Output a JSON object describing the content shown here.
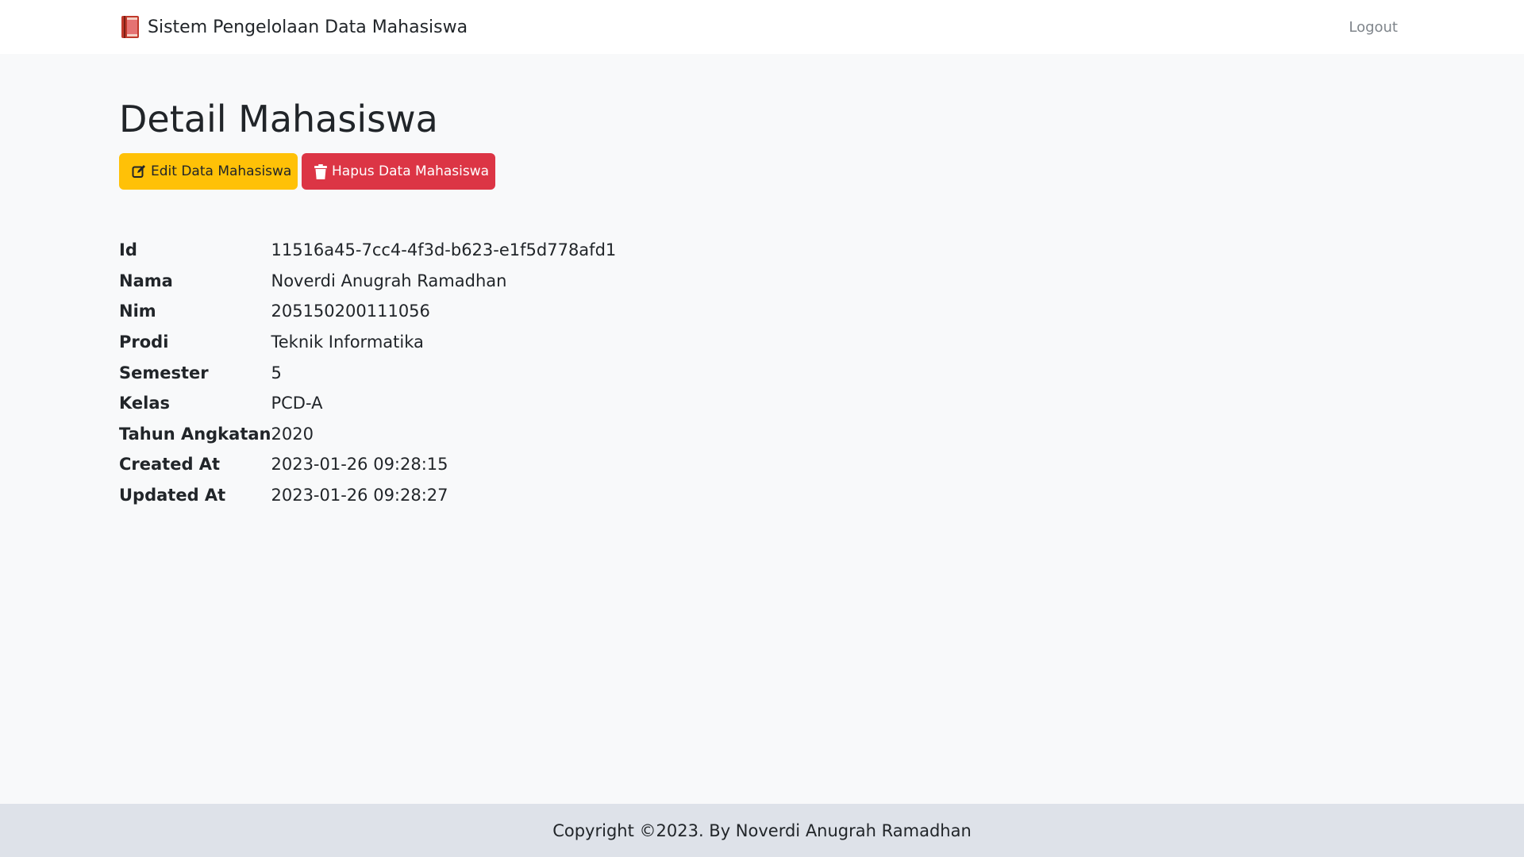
{
  "navbar": {
    "brand_icon": "book-icon",
    "brand_text": "Sistem Pengelolaan Data Mahasiswa",
    "logout_label": "Logout"
  },
  "page": {
    "title": "Detail Mahasiswa"
  },
  "actions": {
    "edit": {
      "icon": "edit-icon",
      "label": "Edit Data Mahasiswa",
      "color": "#ffc107"
    },
    "delete": {
      "icon": "trash-icon",
      "label": "Hapus Data Mahasiswa",
      "color": "#dc3545"
    }
  },
  "details": [
    {
      "label": "Id",
      "value": "11516a45-7cc4-4f3d-b623-e1f5d778afd1"
    },
    {
      "label": "Nama",
      "value": "Noverdi Anugrah Ramadhan"
    },
    {
      "label": "Nim",
      "value": "205150200111056"
    },
    {
      "label": "Prodi",
      "value": "Teknik Informatika"
    },
    {
      "label": "Semester",
      "value": "5"
    },
    {
      "label": "Kelas",
      "value": "PCD-A"
    },
    {
      "label": "Tahun Angkatan",
      "value": "2020"
    },
    {
      "label": "Created At",
      "value": "2023-01-26 09:28:15"
    },
    {
      "label": "Updated At",
      "value": "2023-01-26 09:28:27"
    }
  ],
  "footer": {
    "text": "Copyright ©2023. By Noverdi Anugrah Ramadhan"
  }
}
